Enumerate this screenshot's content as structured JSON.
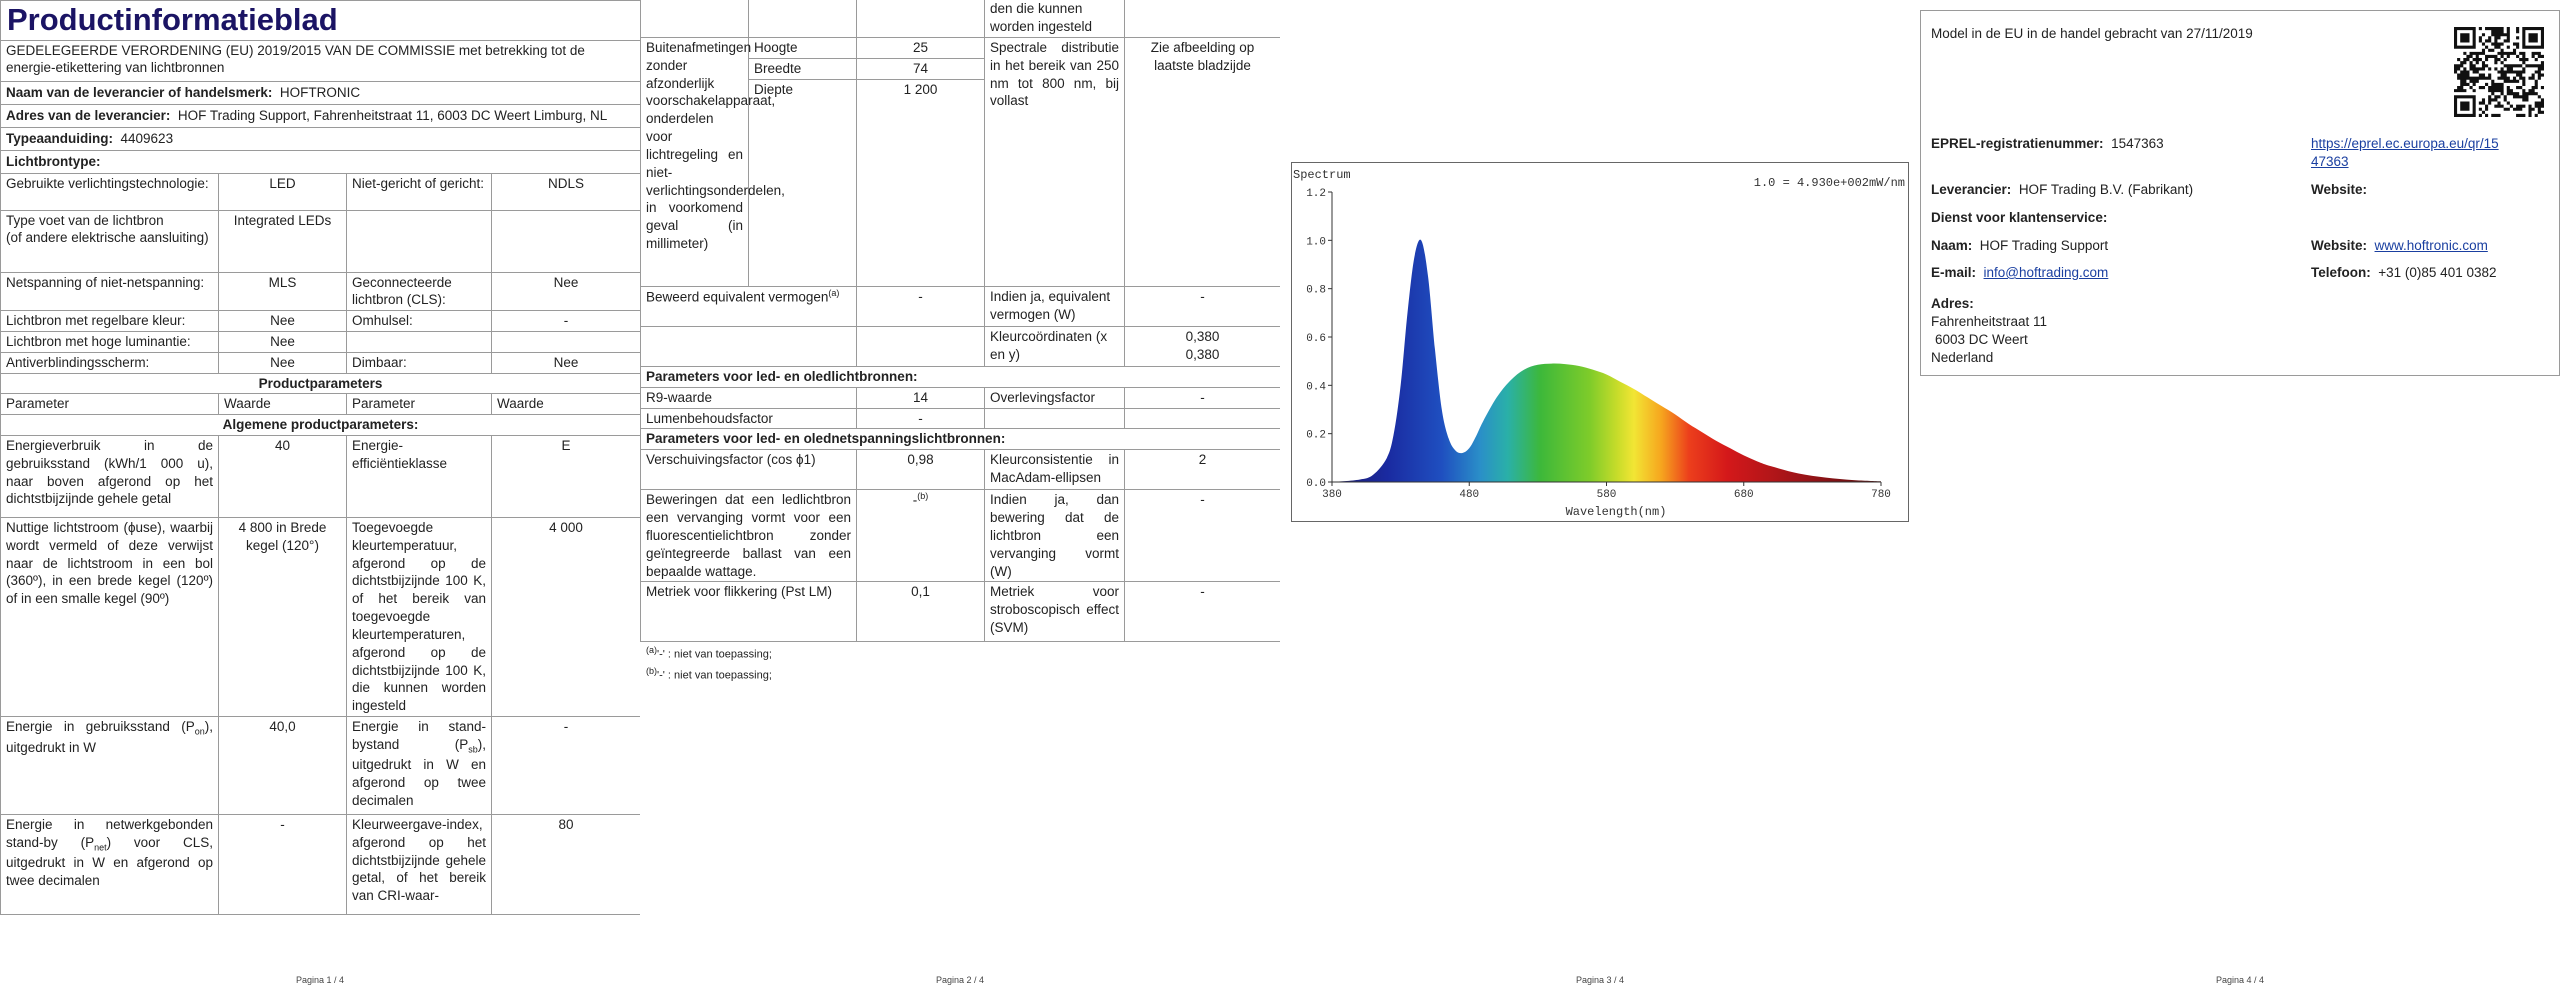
{
  "page1": {
    "title": "Productinformatieblad",
    "regulation": "GEDELEGEERDE VERORDENING (EU) 2019/2015 VAN DE COMMISSIE met betrekking tot de energie-etikettering van lichtbronnen",
    "trademark_label": "Naam van de leverancier of handelsmerk:",
    "trademark_value": "HOFTRONIC",
    "address_label": "Adres van de leverancier:",
    "address_value": "HOF Trading Support, Fahrenheitstraat 11, 6003 DC Weert Limburg, NL",
    "type_label": "Typeaanduiding:",
    "type_value": "4409623",
    "lightsource_label": "Lichtbrontype:",
    "rows": [
      {
        "l1": "Gebruikte verlichtingstechnologie:",
        "v1": "LED",
        "l2": "Niet-gericht of gericht:",
        "v2": "NDLS"
      },
      {
        "l1": "Type voet van de lichtbron",
        "l1b": "(of andere elektrische aansluiting)",
        "v1": "Integrated LEDs",
        "l2": "",
        "v2": ""
      },
      {
        "l1": "Netspanning of niet-netspanning:",
        "v1": "MLS",
        "l2": "Geconnecteerde lichtbron (CLS):",
        "v2": "Nee"
      },
      {
        "l1": "Lichtbron met regelbare kleur:",
        "v1": "Nee",
        "l2": "Omhulsel:",
        "v2": "-"
      },
      {
        "l1": "Lichtbron met hoge luminantie:",
        "v1": "Nee",
        "l2": "",
        "v2": ""
      },
      {
        "l1": "Antiverblindingsscherm:",
        "v1": "Nee",
        "l2": "Dimbaar:",
        "v2": "Nee"
      }
    ],
    "params_heading": "Productparameters",
    "col_param": "Parameter",
    "col_value": "Waarde",
    "general_heading": "Algemene productparameters:",
    "g1": {
      "l1": "Energieverbruik in de gebruiksstand (kWh/1 000 u), naar boven afgerond op het dichtstbijzijnde gehele getal",
      "v1": "40",
      "l2": "Energie-efficiëntieklasse",
      "v2": "E"
    },
    "g2": {
      "l1": "Nuttige lichtstroom (ϕuse), waarbij wordt vermeld of deze verwijst naar de lichtstroom in een bol (360º), in een brede kegel (120º) of in een smalle kegel (90º)",
      "v1": "4 800 in Brede kegel (120°)",
      "l2": "Toegevoegde kleurtemperatuur, afgerond op de dichtstbijzijnde 100 K, of het bereik van toegevoegde kleurtemperaturen, afgerond op de dichtstbijzijnde 100 K, die kunnen worden ingesteld",
      "v2": "4 000"
    },
    "g3": {
      "l1a": "Energie in gebruiksstand (P",
      "l1sub": "on",
      "l1b": "), uitgedrukt in W",
      "v1": "40,0",
      "l2a": "Energie in stand-bystand (P",
      "l2sub": "sb",
      "l2b": "), uitgedrukt in W en afgerond op twee decimalen",
      "v2": "-"
    },
    "g4": {
      "l1a": "Energie in netwerkgebonden stand-by (P",
      "l1sub": "net",
      "l1b": ") voor CLS, uitgedrukt in W en afgerond op twee decimalen",
      "v1": "-",
      "l2": "Kleurweergave-index, afgerond op het dichtstbijzijnde gehele getal, of het bereik van CRI-waar-",
      "v2": "80"
    },
    "page_number": "Pagina 1 / 4"
  },
  "page2": {
    "top_cont": "den die kunnen worden ingesteld",
    "dim_label": "Buitenafmetingen zonder afzonderlijk voorschakelapparaat, onderdelen voor lichtregeling en niet-verlichtingsonderdelen, in voorkomend geval (in millimeter)",
    "dims": [
      {
        "name": "Hoogte",
        "value": "25"
      },
      {
        "name": "Breedte",
        "value": "74"
      },
      {
        "name": "Diepte",
        "value": "1 200"
      }
    ],
    "spectral_label": "Spectrale distributie in het bereik van 250 nm tot 800 nm, bij vollast",
    "spectral_value": "Zie afbeelding op laatste bladzijde",
    "equiv_label": "Beweerd equivalent vermogen",
    "equiv_sup": "(a)",
    "equiv_value": "-",
    "equiv2_label": "Indien ja, equivalent vermogen (W)",
    "equiv2_value": "-",
    "coord_label": "Kleurcoördinaten (x en y)",
    "coord_x": "0,380",
    "coord_y": "0,380",
    "led_heading": "Parameters voor led- en oledlichtbronnen:",
    "r9_label": "R9-waarde",
    "r9_value": "14",
    "survival_label": "Overlevingsfactor",
    "survival_value": "-",
    "lumen_label": "Lumenbehoudsfactor",
    "lumen_value": "-",
    "mains_heading": "Parameters voor led- en olednetspanningslichtbronnen:",
    "cos_label": "Verschuivingsfactor (cos ϕ1)",
    "cos_value": "0,98",
    "macadam_label": "Kleurconsistentie in MacAdam-ellipsen",
    "macadam_value": "2",
    "claims_label": "Beweringen dat een ledlichtbron een vervanging vormt voor een fluorescentielichtbron zonder geïntegreerde ballast van een bepaalde wattage.",
    "claims_value": "-",
    "claims_sup": "(b)",
    "claims2_label": "Indien ja, dan bewering dat de lichtbron een vervanging vormt (W)",
    "claims2_value": "-",
    "flicker_label": "Metriek voor flikkering (Pst LM)",
    "flicker_value": "0,1",
    "strobo_label": "Metriek voor stroboscopisch effect (SVM)",
    "strobo_value": "-",
    "fn_a_mark": "(a)",
    "fn_a_text": "'-' : niet van toepassing;",
    "fn_b_mark": "(b)",
    "fn_b_text": "'-' : niet van toepassing;",
    "page_number": "Pagina 2 / 4"
  },
  "page3": {
    "page_number": "Pagina 3 / 4"
  },
  "chart_data": {
    "type": "area",
    "title": "Spectrum",
    "annotation": "1.0 = 4.930e+002mW/nm",
    "xlabel": "Wavelength(nm)",
    "ylabel": "",
    "xlim": [
      380,
      780
    ],
    "ylim": [
      0,
      1.2
    ],
    "xticks": [
      "380",
      "480",
      "580",
      "680",
      "780"
    ],
    "yticks": [
      "0.0",
      "0.2",
      "0.4",
      "0.6",
      "0.8",
      "1.0",
      "1.2"
    ],
    "grid": false,
    "x": [
      380,
      400,
      410,
      420,
      425,
      430,
      435,
      440,
      445,
      450,
      455,
      460,
      465,
      470,
      475,
      480,
      485,
      490,
      500,
      510,
      520,
      530,
      540,
      550,
      560,
      570,
      580,
      590,
      600,
      610,
      620,
      630,
      640,
      650,
      660,
      670,
      680,
      690,
      700,
      720,
      740,
      760,
      780
    ],
    "y": [
      0.0,
      0.01,
      0.03,
      0.1,
      0.2,
      0.4,
      0.7,
      0.93,
      1.0,
      0.85,
      0.55,
      0.3,
      0.18,
      0.13,
      0.12,
      0.14,
      0.19,
      0.25,
      0.35,
      0.42,
      0.465,
      0.485,
      0.49,
      0.488,
      0.48,
      0.465,
      0.445,
      0.415,
      0.385,
      0.35,
      0.315,
      0.28,
      0.24,
      0.205,
      0.17,
      0.14,
      0.11,
      0.085,
      0.065,
      0.035,
      0.018,
      0.008,
      0.003
    ]
  },
  "page4": {
    "market_date": "Model in de EU in de handel gebracht van 27/11/2019",
    "eprel_label": "EPREL-registratienummer:",
    "eprel_value": "1547363",
    "eprel_link_1": "https://eprel.ec.europa.eu/qr/15",
    "eprel_link_2": "47363",
    "supplier_label": "Leverancier:",
    "supplier_value": "HOF Trading B.V. (Fabrikant)",
    "website_label": "Website:",
    "service_heading": "Dienst voor klantenservice:",
    "name_label": "Naam:",
    "name_value": "HOF Trading Support",
    "website2_label": "Website:",
    "website2_value": "www.hoftronic.com",
    "email_label": "E-mail:",
    "email_value": "info@hoftrading.com",
    "phone_label": "Telefoon:",
    "phone_value": "+31 (0)85 401 0382",
    "address_label": "Adres:",
    "address_lines": [
      "Fahrenheitstraat 11",
      "6003 DC Weert",
      "Nederland"
    ],
    "page_number": "Pagina 4 / 4"
  }
}
